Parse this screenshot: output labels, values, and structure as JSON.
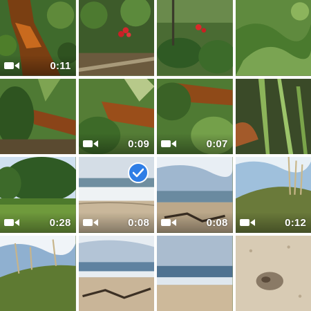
{
  "app": "Photos",
  "selection_color": "#2f7ee6",
  "tiles": [
    {
      "kind": "video",
      "duration": "0:11",
      "icon": "video-camera-icon"
    },
    {
      "kind": "photo"
    },
    {
      "kind": "photo"
    },
    {
      "kind": "photo"
    },
    {
      "kind": "photo"
    },
    {
      "kind": "video",
      "duration": "0:09",
      "icon": "video-camera-icon"
    },
    {
      "kind": "video",
      "duration": "0:07",
      "icon": "video-camera-icon"
    },
    {
      "kind": "photo"
    },
    {
      "kind": "video",
      "duration": "0:28",
      "icon": "video-camera-icon"
    },
    {
      "kind": "video",
      "duration": "0:08",
      "icon": "video-camera-icon",
      "selected": true,
      "selected_icon": "checkmark-icon"
    },
    {
      "kind": "video",
      "duration": "0:08",
      "icon": "video-camera-icon"
    },
    {
      "kind": "video",
      "duration": "0:12",
      "icon": "video-camera-icon"
    },
    {
      "kind": "photo"
    },
    {
      "kind": "photo"
    },
    {
      "kind": "photo"
    },
    {
      "kind": "photo"
    }
  ]
}
